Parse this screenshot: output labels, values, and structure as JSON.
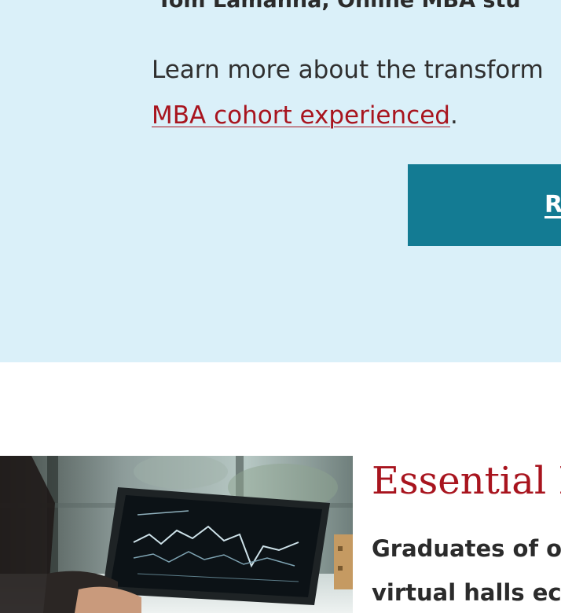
{
  "testimonial": {
    "attribution": "Tom Lamanna, Online MBA stu"
  },
  "learn_more": {
    "prefix": "Learn more about the transform",
    "link_text": "MBA cohort experienced",
    "suffix": "."
  },
  "cta": {
    "label": "R"
  },
  "section": {
    "title": "Essential B",
    "lead_line1": "Graduates of o",
    "lead_line2": "virtual halls ec"
  },
  "colors": {
    "band_background": "#daf0f9",
    "accent_red": "#a8141e",
    "cta_teal": "#137b93"
  },
  "icons": {
    "photo": "laptop-stock-chart-photo"
  }
}
